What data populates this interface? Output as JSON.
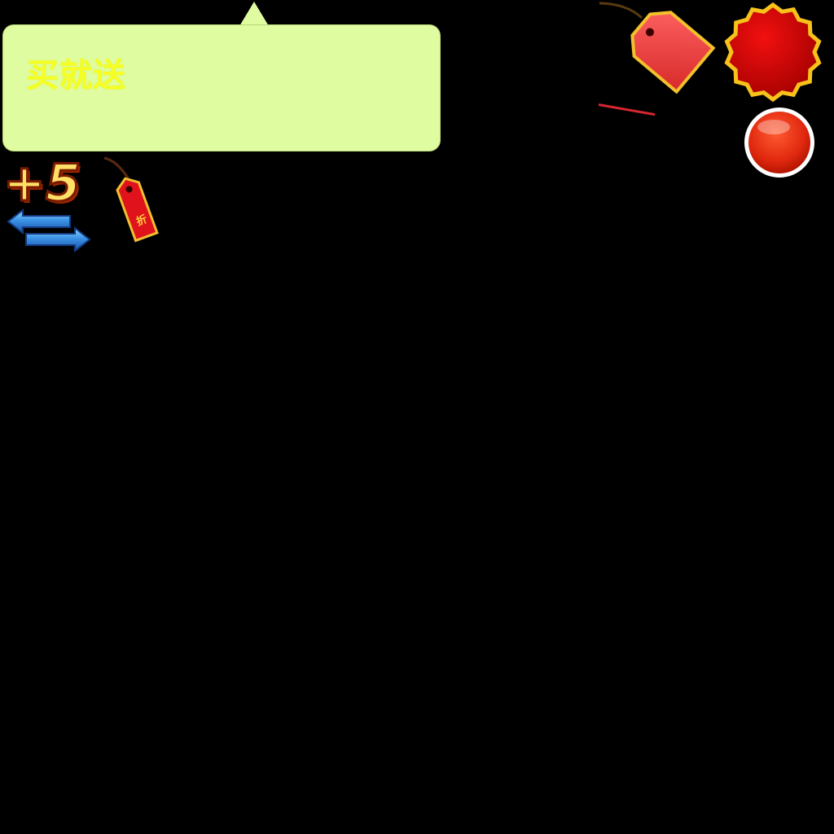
{
  "bubble": {
    "text": "买就送",
    "fill_color": "#dffca0",
    "text_color": "#f5ff26"
  },
  "bonus": {
    "text": "+5",
    "color": "#ffe066"
  },
  "small_tag": {
    "char": "折",
    "color": "#e0121b"
  },
  "colors": {
    "background": "#000000",
    "tag_red": "#f04848",
    "seal_gold": "#f7c21a",
    "button_red": "#e5301c",
    "arrow_blue": "#2f86e0"
  },
  "icons": {
    "arrows": "swap-arrows-icon",
    "big_tag": "price-tag-icon",
    "small_tag": "discount-tag-icon",
    "seal": "starburst-seal-icon",
    "button": "red-round-button-icon"
  }
}
